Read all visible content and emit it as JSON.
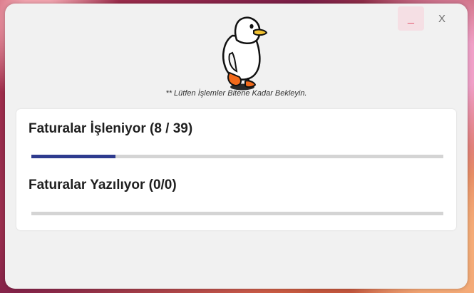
{
  "window": {
    "minimize_label": "_",
    "close_label": "X",
    "wait_note": "** Lütfen İşlemler Bitene Kadar Bekleyin."
  },
  "progress": {
    "invoices_processing": {
      "label": "Faturalar İşleniyor (8 / 39)",
      "current": 8,
      "total": 39,
      "fraction": 0.205,
      "color": "#2e3b8e"
    },
    "invoices_writing": {
      "label": "Faturalar Yazılıyor (0/0)",
      "current": 0,
      "total": 0,
      "fraction": 0
    }
  },
  "icons": {
    "mascot": "duck-mascot-icon",
    "minimize": "minimize-icon",
    "close": "close-icon"
  }
}
